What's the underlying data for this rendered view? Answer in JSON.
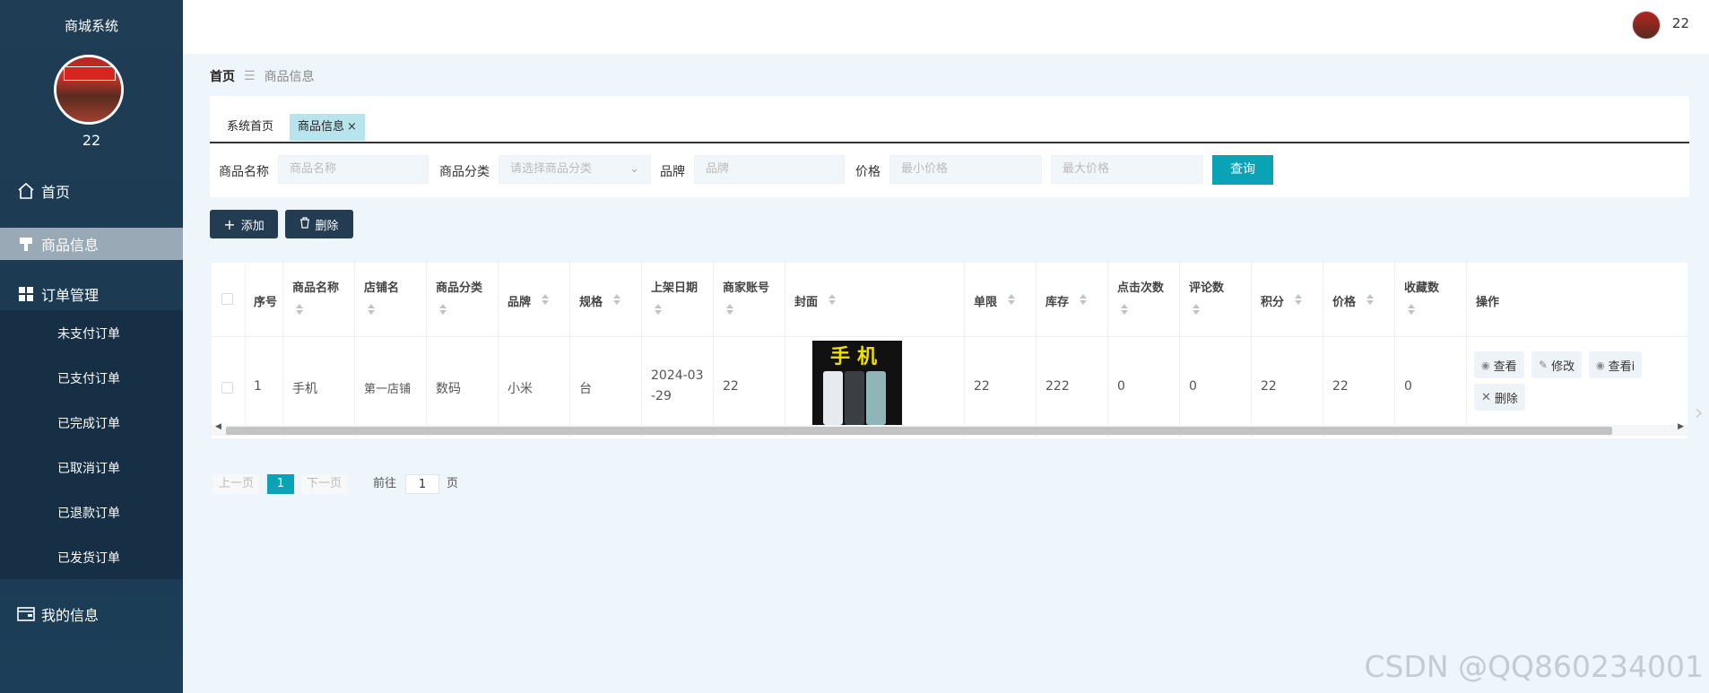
{
  "sidebar": {
    "title": "商城系统",
    "username": "22",
    "nav": {
      "home": "首页",
      "goods": "商品信息",
      "orders": "订单管理",
      "me": "我的信息"
    },
    "order_items": [
      "未支付订单",
      "已支付订单",
      "已完成订单",
      "已取消订单",
      "已退款订单",
      "已发货订单"
    ]
  },
  "topbar": {
    "username": "22"
  },
  "breadcrumb": {
    "home": "首页",
    "sep": "☰",
    "current": "商品信息"
  },
  "tabs": {
    "home": "系统首页",
    "goods": "商品信息",
    "close": "×"
  },
  "filters": {
    "name_label": "商品名称",
    "name_placeholder": "商品名称",
    "category_label": "商品分类",
    "category_placeholder": "请选择商品分类",
    "brand_label": "品牌",
    "brand_placeholder": "品牌",
    "price_label": "价格",
    "min_price_placeholder": "最小价格",
    "max_price_placeholder": "最大价格",
    "query_label": "查询"
  },
  "actions": {
    "add": "添加",
    "delete": "删除"
  },
  "table": {
    "headers": [
      "序号",
      "商品名称",
      "店铺名",
      "商品分类",
      "品牌",
      "规格",
      "上架日期",
      "商家账号",
      "封面",
      "单限",
      "库存",
      "点击次数",
      "评论数",
      "积分",
      "价格",
      "收藏数",
      "操作"
    ],
    "row": {
      "index": "1",
      "name": "手机",
      "shop": "第一店铺",
      "category": "数码",
      "brand": "小米",
      "spec": "台",
      "date_line1": "2024-03",
      "date_line2": "-29",
      "account": "22",
      "cover_text": "手机",
      "limit": "22",
      "stock": "222",
      "clicks": "0",
      "comments": "0",
      "points": "22",
      "price": "22",
      "favorites": "0"
    },
    "ops": {
      "view": "查看",
      "edit": "修改",
      "view2": "查看i",
      "delete": "删除"
    }
  },
  "pager": {
    "prev": "上一页",
    "current": "1",
    "next": "下一页",
    "goto": "前往",
    "page_value": "1",
    "page_unit": "页"
  },
  "watermark": "CSDN @QQ860234001",
  "colors": {
    "sidebar": "#1f3d55",
    "accent": "#0aa3b5",
    "button_dark": "#233c52"
  }
}
